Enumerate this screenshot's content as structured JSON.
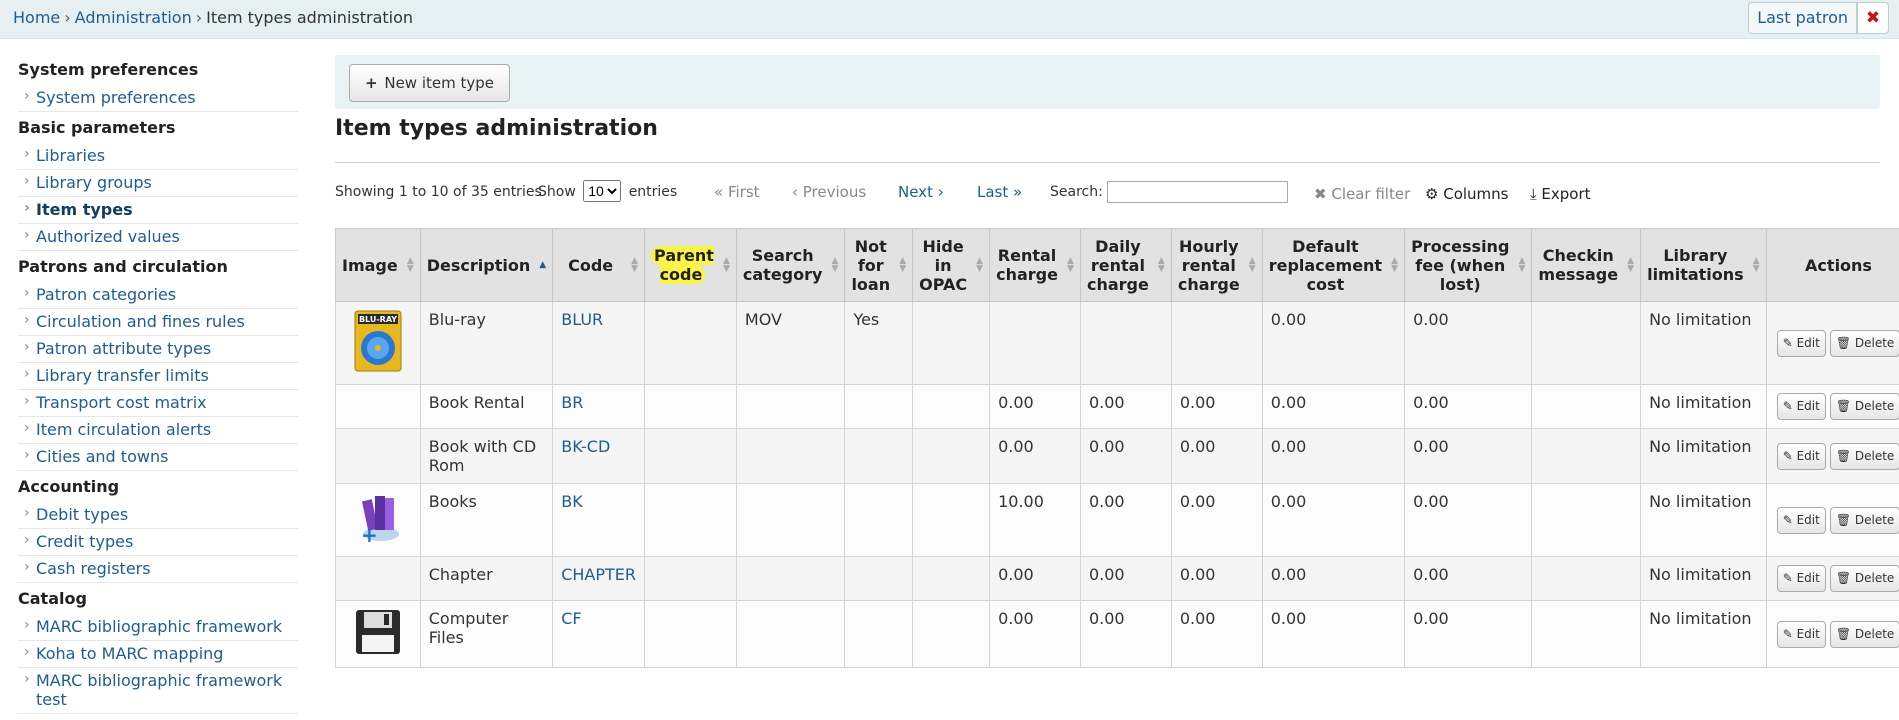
{
  "breadcrumb": {
    "home": "Home",
    "admin": "Administration",
    "current": "Item types administration",
    "sep": "›"
  },
  "top": {
    "last_patron": "Last patron",
    "close": "✖"
  },
  "sidebar": {
    "sections": [
      {
        "heading": "System preferences",
        "items": [
          {
            "label": "System preferences",
            "active": false
          }
        ]
      },
      {
        "heading": "Basic parameters",
        "items": [
          {
            "label": "Libraries",
            "active": false
          },
          {
            "label": "Library groups",
            "active": false
          },
          {
            "label": "Item types",
            "active": true
          },
          {
            "label": "Authorized values",
            "active": false
          }
        ]
      },
      {
        "heading": "Patrons and circulation",
        "items": [
          {
            "label": "Patron categories",
            "active": false
          },
          {
            "label": "Circulation and fines rules",
            "active": false
          },
          {
            "label": "Patron attribute types",
            "active": false
          },
          {
            "label": "Library transfer limits",
            "active": false
          },
          {
            "label": "Transport cost matrix",
            "active": false
          },
          {
            "label": "Item circulation alerts",
            "active": false
          },
          {
            "label": "Cities and towns",
            "active": false
          }
        ]
      },
      {
        "heading": "Accounting",
        "items": [
          {
            "label": "Debit types",
            "active": false
          },
          {
            "label": "Credit types",
            "active": false
          },
          {
            "label": "Cash registers",
            "active": false
          }
        ]
      },
      {
        "heading": "Catalog",
        "items": [
          {
            "label": "MARC bibliographic framework",
            "active": false
          },
          {
            "label": "Koha to MARC mapping",
            "active": false
          },
          {
            "label": "MARC bibliographic framework test",
            "active": false
          }
        ]
      }
    ]
  },
  "toolbar": {
    "new_item_type": "New item type",
    "plus": "+"
  },
  "page_title": "Item types administration",
  "datatable": {
    "info": "Showing 1 to 10 of 35 entries",
    "show": "Show",
    "length_value": "10",
    "entries": "entries",
    "first": "« First",
    "previous": "‹ Previous",
    "next": "Next ›",
    "last": "Last »",
    "search_label": "Search:",
    "search_value": "",
    "clear_filter": "Clear filter",
    "clear_icon": "✖",
    "columns": "Columns",
    "columns_icon": "⚙",
    "export": "Export",
    "export_icon": "⤓"
  },
  "table": {
    "columns": [
      "Image",
      "Description",
      "Code",
      "Parent code",
      "Search category",
      "Not for loan",
      "Hide in OPAC",
      "Rental charge",
      "Daily rental charge",
      "Hourly rental charge",
      "Default replacement cost",
      "Processing fee (when lost)",
      "Checkin message",
      "Library limitations",
      "Actions"
    ],
    "edit_label": "Edit",
    "delete_label": "Delete",
    "edit_icon": "✎",
    "delete_icon": "🗑",
    "rows": [
      {
        "image": "bluray-icon",
        "image_text": "BLU-RAY",
        "description": "Blu-ray",
        "code": "BLUR",
        "parent": "",
        "search_category": "MOV",
        "not_for_loan": "Yes",
        "hide_opac": "",
        "rental": "",
        "daily": "",
        "hourly": "",
        "replacement": "0.00",
        "processing": "0.00",
        "checkin": "",
        "limitations": "No limitation"
      },
      {
        "image": "",
        "image_text": "",
        "description": "Book Rental",
        "code": "BR",
        "parent": "",
        "search_category": "",
        "not_for_loan": "",
        "hide_opac": "",
        "rental": "0.00",
        "daily": "0.00",
        "hourly": "0.00",
        "replacement": "0.00",
        "processing": "0.00",
        "checkin": "",
        "limitations": "No limitation"
      },
      {
        "image": "",
        "image_text": "",
        "description": "Book with CD Rom",
        "code": "BK-CD",
        "parent": "",
        "search_category": "",
        "not_for_loan": "",
        "hide_opac": "",
        "rental": "0.00",
        "daily": "0.00",
        "hourly": "0.00",
        "replacement": "0.00",
        "processing": "0.00",
        "checkin": "",
        "limitations": "No limitation"
      },
      {
        "image": "books-icon",
        "image_text": "",
        "description": "Books",
        "code": "BK",
        "parent": "",
        "search_category": "",
        "not_for_loan": "",
        "hide_opac": "",
        "rental": "10.00",
        "daily": "0.00",
        "hourly": "0.00",
        "replacement": "0.00",
        "processing": "0.00",
        "checkin": "",
        "limitations": "No limitation"
      },
      {
        "image": "",
        "image_text": "",
        "description": "Chapter",
        "code": "CHAPTER",
        "parent": "",
        "search_category": "",
        "not_for_loan": "",
        "hide_opac": "",
        "rental": "0.00",
        "daily": "0.00",
        "hourly": "0.00",
        "replacement": "0.00",
        "processing": "0.00",
        "checkin": "",
        "limitations": "No limitation"
      },
      {
        "image": "floppy-disk-icon",
        "image_text": "",
        "description": "Computer Files",
        "code": "CF",
        "parent": "",
        "search_category": "",
        "not_for_loan": "",
        "hide_opac": "",
        "rental": "0.00",
        "daily": "0.00",
        "hourly": "0.00",
        "replacement": "0.00",
        "processing": "0.00",
        "checkin": "",
        "limitations": "No limitation"
      }
    ]
  },
  "colors": {
    "link": "#1f5d8f",
    "highlight": "#fbf34a",
    "header_bg": "#e2e2e2",
    "topbar_bg": "#e6f0f2"
  }
}
